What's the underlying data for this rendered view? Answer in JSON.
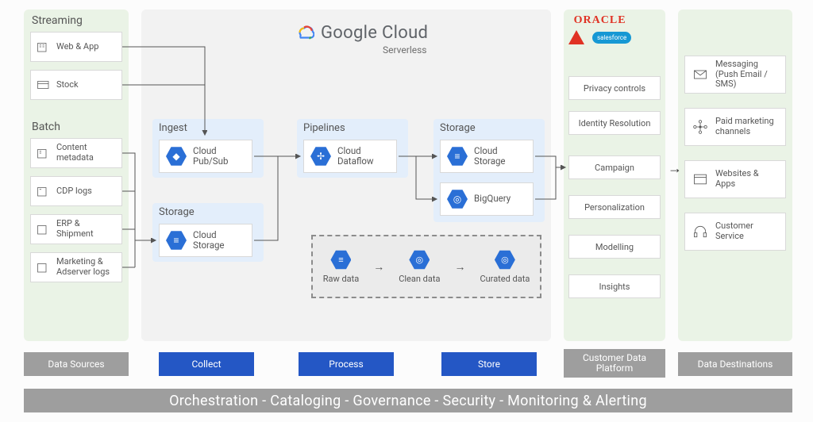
{
  "header": {
    "brand": "Google Cloud",
    "subtitle": "Serverless"
  },
  "vendors": {
    "oracle": "ORACLE",
    "salesforce": "salesforce"
  },
  "sources": {
    "streaming_heading": "Streaming",
    "batch_heading": "Batch",
    "streaming": [
      {
        "label": "Web & App"
      },
      {
        "label": "Stock"
      }
    ],
    "batch": [
      {
        "label": "Content metadata"
      },
      {
        "label": "CDP logs"
      },
      {
        "label": "ERP & Shipment"
      },
      {
        "label": "Marketing & Adserver logs"
      }
    ]
  },
  "gcp": {
    "ingest": {
      "heading": "Ingest",
      "service": "Cloud Pub/Sub"
    },
    "storage1": {
      "heading": "Storage",
      "service": "Cloud Storage"
    },
    "pipelines": {
      "heading": "Pipelines",
      "service": "Cloud Dataflow"
    },
    "storage2": {
      "heading": "Storage",
      "services": [
        "Cloud Storage",
        "BigQuery"
      ]
    },
    "progression": [
      "Raw data",
      "Clean data",
      "Curated data"
    ]
  },
  "cdp_items": [
    "Privacy controls",
    "Identity Resolution",
    "Campaign",
    "Personalization",
    "Modelling",
    "Insights"
  ],
  "destinations": [
    "Messaging (Push Email / SMS)",
    "Paid marketing channels",
    "Websites & Apps",
    "Customer Service"
  ],
  "stage_labels": {
    "sources": "Data Sources",
    "collect": "Collect",
    "process": "Process",
    "store": "Store",
    "cdp": "Customer Data Platform",
    "dest": "Data Destinations"
  },
  "banner": "Orchestration - Cataloging - Governance - Security - Monitoring & Alerting"
}
